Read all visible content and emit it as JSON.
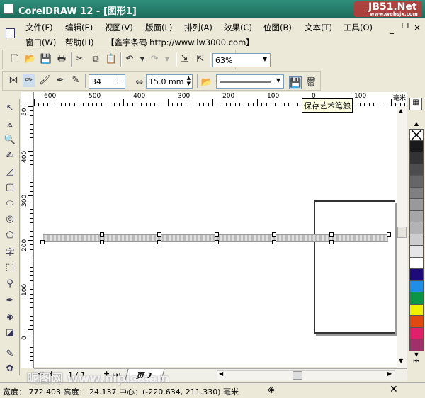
{
  "window": {
    "title": "CorelDRAW 12 - [图形1]",
    "watermark_top": "JB51.Net",
    "watermark_url": "www.websjx.com"
  },
  "menu": {
    "row1": [
      "文件(F)",
      "编辑(E)",
      "视图(V)",
      "版面(L)",
      "排列(A)",
      "效果(C)",
      "位图(B)",
      "文本(T)",
      "工具(O)"
    ],
    "row2": [
      "窗口(W)",
      "帮助(H)",
      "【鑫宇条码 http://www.lw3000.com】"
    ]
  },
  "toolbar": {
    "zoom": "63%"
  },
  "property_bar": {
    "smoothness": "34",
    "width": "15.0 mm"
  },
  "tooltip": "保存艺术笔触",
  "ruler": {
    "top": [
      "600",
      "500",
      "400",
      "300",
      "200",
      "100",
      "0",
      "100"
    ],
    "unit": "毫米",
    "left": [
      "400",
      "300",
      "200",
      "100",
      "0"
    ],
    "left_top": "50"
  },
  "page_nav": {
    "counter": "1 / 1",
    "tab": "页 1"
  },
  "status": {
    "text": "宽度： 772.403 高度： 24.137 中心：(-220.634, 211.330) 毫米"
  },
  "watermark_bottom": "昵图网 www.nipic.com",
  "palette": [
    "#1a1a1a",
    "#333333",
    "#4d4d4d",
    "#666666",
    "#808080",
    "#999999",
    "#a6a6a6",
    "#b3b3b3",
    "#cccccc",
    "#e6e6e6",
    "#ffffff",
    "#1e0a78",
    "#1e8ee6",
    "#0a9646",
    "#f0f000",
    "#e04a10",
    "#e0206a",
    "#a0306a"
  ]
}
